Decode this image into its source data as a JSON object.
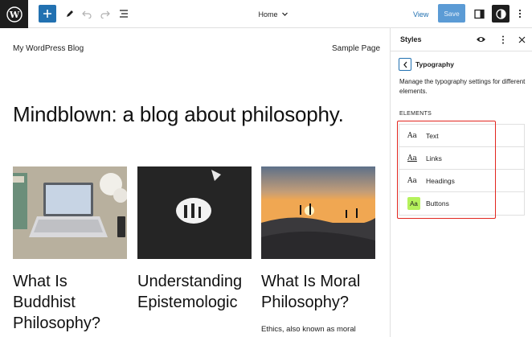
{
  "toolbar": {
    "document_title": "Home",
    "view_label": "View",
    "save_label": "Save"
  },
  "site": {
    "title": "My WordPress Blog",
    "nav_link": "Sample Page",
    "headline": "Mindblown: a blog about philosophy."
  },
  "posts": [
    {
      "title": "What Is Buddhist Philosophy?",
      "excerpt": ""
    },
    {
      "title": "Understanding Epistemologic",
      "excerpt": ""
    },
    {
      "title": "What Is Moral Philosophy?",
      "excerpt": "Ethics, also known as moral"
    }
  ],
  "sidebar": {
    "title": "Styles",
    "subtitle": "Typography",
    "description": "Manage the typography settings for different elements.",
    "section_label": "ELEMENTS",
    "elements": [
      {
        "preview": "Aa",
        "label": "Text"
      },
      {
        "preview": "Aa",
        "label": "Links"
      },
      {
        "preview": "Aa",
        "label": "Headings"
      },
      {
        "preview": "Aa",
        "label": "Buttons"
      }
    ]
  },
  "colors": {
    "accent": "#2271b1",
    "highlight": "#e2261f",
    "button_preview": "#b5f25c"
  }
}
